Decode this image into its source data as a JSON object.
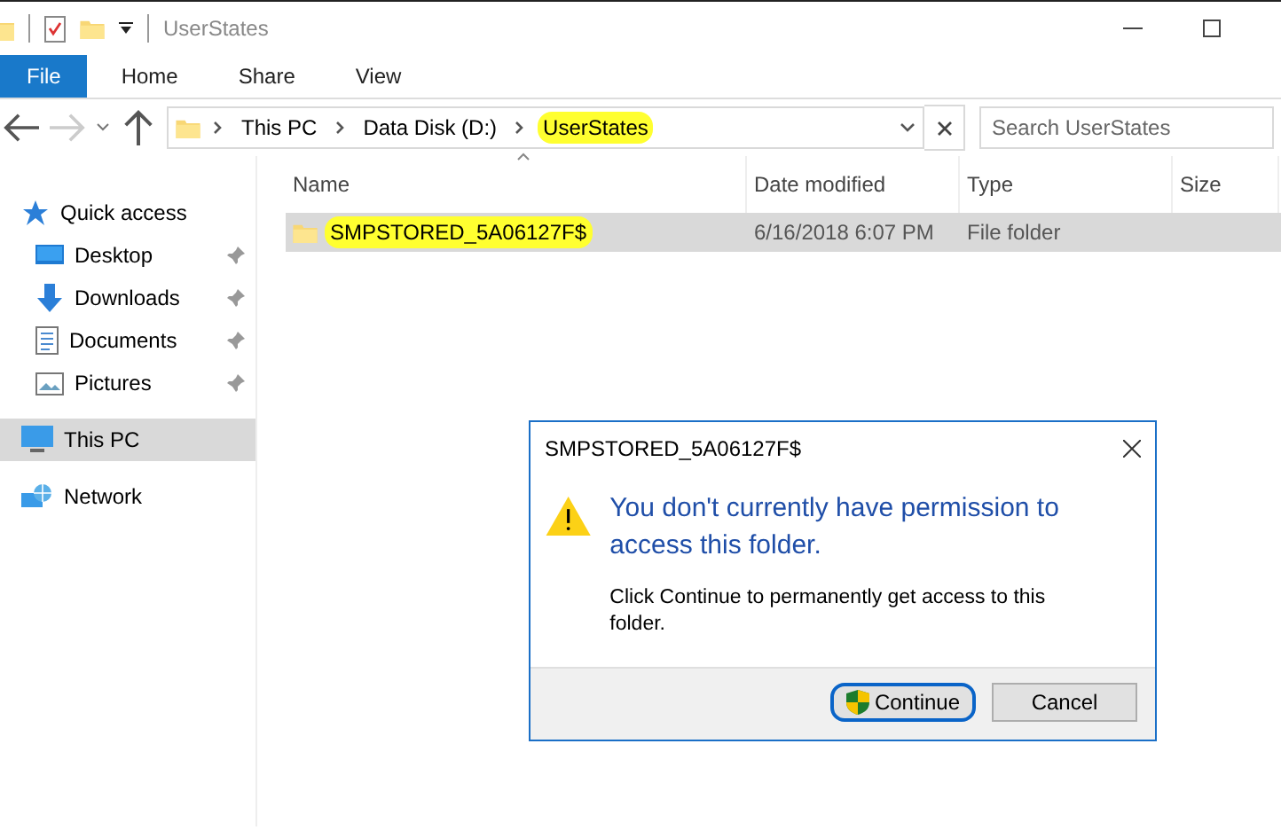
{
  "window": {
    "title": "UserStates"
  },
  "ribbon_tabs": [
    {
      "label": "File",
      "selected": true
    },
    {
      "label": "Home",
      "selected": false
    },
    {
      "label": "Share",
      "selected": false
    },
    {
      "label": "View",
      "selected": false
    }
  ],
  "navigation": {
    "forward_disabled": true
  },
  "address_bar": {
    "crumbs": [
      {
        "label": "This PC",
        "highlighted": false
      },
      {
        "label": "Data Disk (D:)",
        "highlighted": false
      },
      {
        "label": "UserStates",
        "highlighted": true
      }
    ]
  },
  "search": {
    "placeholder": "Search UserStates"
  },
  "sidebar": {
    "items": [
      {
        "label": "Quick access",
        "kind": "quick-access",
        "selected": false,
        "children": [
          {
            "label": "Desktop",
            "kind": "desktop",
            "pinned": true,
            "selected": false
          },
          {
            "label": "Downloads",
            "kind": "downloads",
            "pinned": true,
            "selected": false
          },
          {
            "label": "Documents",
            "kind": "documents",
            "pinned": true,
            "selected": false
          },
          {
            "label": "Pictures",
            "kind": "pictures",
            "pinned": true,
            "selected": false
          }
        ]
      },
      {
        "label": "This PC",
        "kind": "this-pc",
        "selected": true
      },
      {
        "label": "Network",
        "kind": "network",
        "selected": false
      }
    ]
  },
  "table": {
    "columns": [
      {
        "label": "Name",
        "sorted": true
      },
      {
        "label": "Date modified",
        "sorted": false
      },
      {
        "label": "Type",
        "sorted": false
      },
      {
        "label": "Size",
        "sorted": false
      }
    ],
    "rows": [
      {
        "name": "SMPSTORED_5A06127F$",
        "date_modified": "6/16/2018 6:07 PM",
        "type": "File folder",
        "selected": true,
        "highlighted": true
      }
    ]
  },
  "dialog": {
    "title": "SMPSTORED_5A06127F$",
    "heading": "You don't currently have permission to access this folder.",
    "message": "Click Continue to permanently get access to this folder.",
    "buttons": [
      {
        "label": "Continue",
        "kind": "shield",
        "default": true,
        "highlighted": true
      },
      {
        "label": "Cancel",
        "kind": "plain",
        "default": false,
        "highlighted": false
      }
    ]
  }
}
